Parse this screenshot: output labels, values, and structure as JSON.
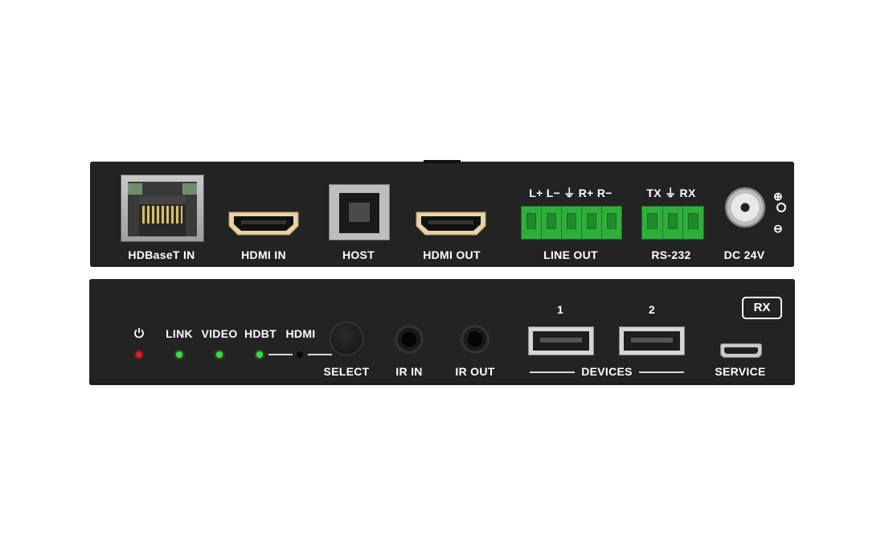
{
  "back_panel": {
    "hdbaset_in": "HDBaseT IN",
    "hdmi_in": "HDMI IN",
    "host": "HOST",
    "hdmi_out": "HDMI OUT",
    "line_out": "LINE OUT",
    "line_out_pins": "L+ L− ⏚ R+ R−",
    "rs232": "RS-232",
    "rs232_pins": "TX ⏚ RX",
    "dc": "DC 24V",
    "polarity": [
      "⊕",
      "⊖"
    ]
  },
  "front_panel": {
    "power_icon": "power-icon",
    "link": "LINK",
    "video": "VIDEO",
    "hdbt": "HDBT",
    "hdmi": "HDMI",
    "select": "SELECT",
    "ir_in": "IR IN",
    "ir_out": "IR OUT",
    "usb_port_1": "1",
    "usb_port_2": "2",
    "devices": "DEVICES",
    "service": "SERVICE",
    "badge": "RX"
  },
  "colors": {
    "chassis": "#232323",
    "led_green": "#3ddc3d",
    "led_red": "#e02020",
    "terminal_green": "#2fae3c"
  }
}
